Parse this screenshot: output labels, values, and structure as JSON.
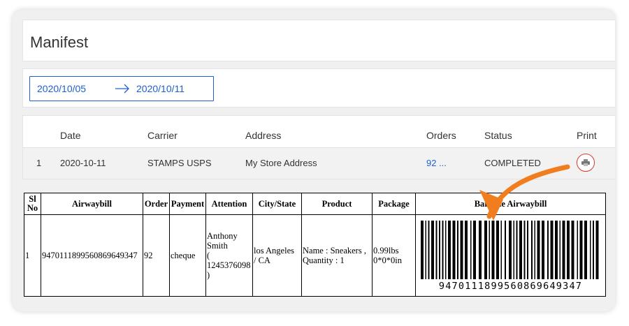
{
  "page": {
    "title": "Manifest"
  },
  "date_range": {
    "start": "2020/10/05",
    "end": "2020/10/11",
    "arrow_icon": "right-arrow-icon"
  },
  "manifest_list": {
    "columns": {
      "date": "Date",
      "carrier": "Carrier",
      "address": "Address",
      "orders": "Orders",
      "status": "Status",
      "print": "Print"
    },
    "row": {
      "index": "1",
      "date": "2020-10-11",
      "carrier": "STAMPS USPS",
      "address": "My Store Address",
      "orders": "92 ...",
      "status": "COMPLETED",
      "print_icon": "printer-icon"
    }
  },
  "manifest_table": {
    "headers": {
      "sl_no_1": "Sl",
      "sl_no_2": "No",
      "airwaybill": "Airwaybill",
      "order": "Order",
      "payment": "Payment",
      "attention": "Attention",
      "city_state": "City/State",
      "product": "Product",
      "package": "Package",
      "barcode": "Barcode Airwaybill"
    },
    "row": {
      "sl_no": "1",
      "airwaybill": "9470111899560869649347",
      "order": "92",
      "payment": "cheque",
      "attention_name_1": "Anthony",
      "attention_name_2": "Smith",
      "attention_phone_1": "(",
      "attention_phone_2": "1245376098",
      "attention_phone_3": ")",
      "city_1": "los Angeles",
      "city_2": "/ CA",
      "product_1": "Name : Sneakers ,",
      "product_2": "Quantity : 1",
      "package_1": "0.99lbs",
      "package_2": "0*0*0in",
      "barcode_text": "9470111899560869649347"
    }
  },
  "colors": {
    "accent": "#1d5fd1",
    "callout": "#f07d1e",
    "print_ring": "#d23a2c"
  }
}
